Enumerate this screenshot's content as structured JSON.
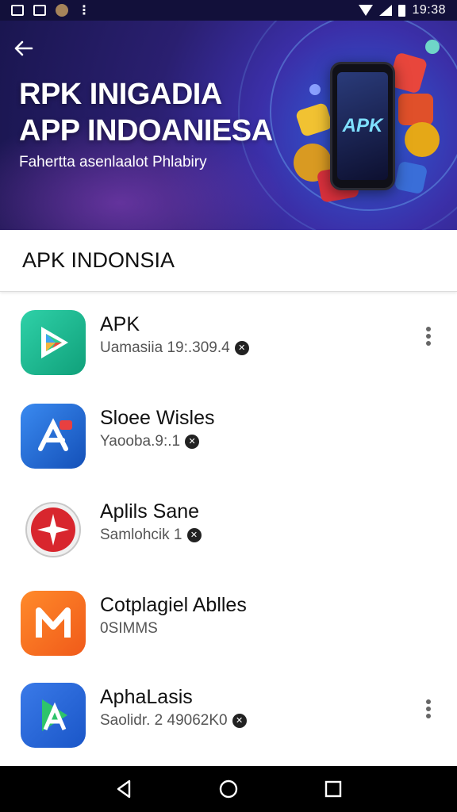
{
  "status_bar": {
    "time": "19:38",
    "left_icons": [
      "gallery-icon",
      "photo-icon",
      "coin-icon",
      "dots-icon"
    ],
    "right_icons": [
      "wifi-icon",
      "signal-icon",
      "battery-icon"
    ]
  },
  "hero": {
    "title_line1": "RPK INIGADIA",
    "title_line2": "APP INDOANIESA",
    "subtitle": "Fahertta asenlaalot Phlabiry",
    "phone_label": "APK"
  },
  "section": {
    "title": "APK INDONSIA"
  },
  "apps": [
    {
      "name": "APK",
      "meta": "Uamasiia 19:.309.4",
      "icon": "play-store-icon",
      "has_menu": true
    },
    {
      "name": "Sloee Wisles",
      "meta": "Yaooba.9:.1",
      "icon": "app-store-icon",
      "has_menu": false
    },
    {
      "name": "Aplils Sane",
      "meta": "Samlohcik 1",
      "icon": "star-badge-icon",
      "has_menu": false
    },
    {
      "name": "Cotplagiel Ablles",
      "meta": "0SIMMS",
      "icon": "m-logo-icon",
      "has_menu": false
    },
    {
      "name": "AphaLasis",
      "meta": "Saolidr. 2 49062K0",
      "icon": "a-logo-icon",
      "has_menu": true
    }
  ],
  "nav": [
    "back-icon",
    "home-icon",
    "recents-icon"
  ],
  "colors": {
    "status_bg": "#12103a",
    "hero_bg": "#2a1f70",
    "accent_blue": "#2b5fd8",
    "nav_bg": "#000000"
  }
}
